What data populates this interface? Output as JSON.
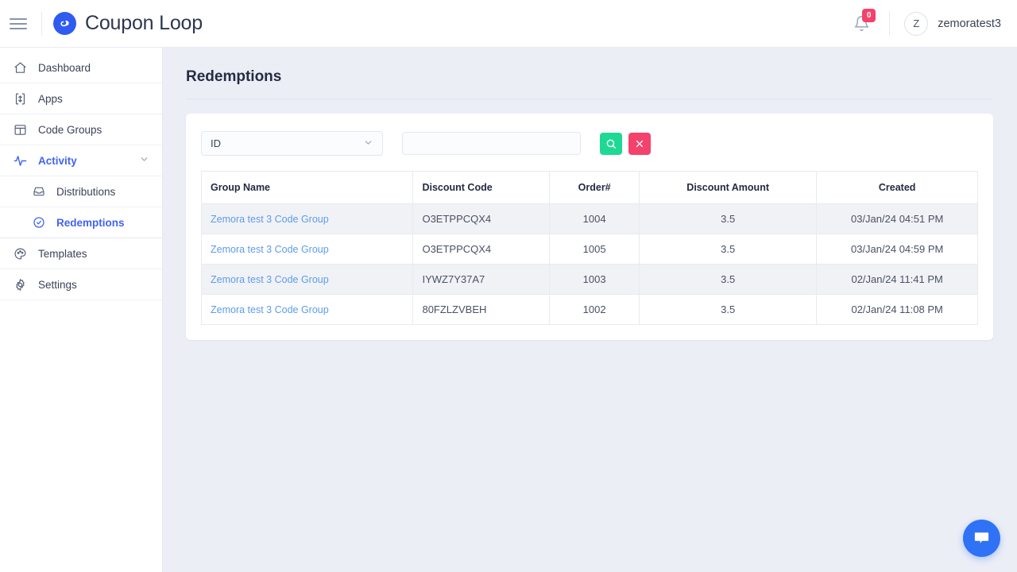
{
  "app": {
    "brand_name": "Coupon Loop",
    "logo_icon": "infinity-loop-icon",
    "menu_icon": "hamburger-menu-icon",
    "accent_blue": "#2f5bf0",
    "bg": "#eceef6"
  },
  "topbar": {
    "notifications": {
      "icon": "bell-icon",
      "badge_count": "0",
      "badge_color": "#f5426c"
    },
    "user": {
      "avatar_initial": "Z",
      "name": "zemoratest3"
    }
  },
  "sidebar": {
    "items": [
      {
        "label": "Dashboard",
        "icon": "home-icon",
        "active": false
      },
      {
        "label": "Apps",
        "icon": "apps-icon",
        "active": false
      },
      {
        "label": "Code Groups",
        "icon": "layout-icon",
        "active": false
      },
      {
        "label": "Activity",
        "icon": "activity-pulse-icon",
        "active": true,
        "expanded": true,
        "chevron": "chevron-down-icon"
      },
      {
        "label": "Templates",
        "icon": "palette-icon",
        "active": false
      },
      {
        "label": "Settings",
        "icon": "gear-icon",
        "active": false
      }
    ],
    "subitems": [
      {
        "label": "Distributions",
        "icon": "inbox-icon",
        "active": false
      },
      {
        "label": "Redemptions",
        "icon": "check-circle-icon",
        "active": true
      }
    ]
  },
  "page": {
    "title": "Redemptions"
  },
  "filters": {
    "field_select": {
      "value": "ID",
      "options": [
        "ID"
      ],
      "chevron": "chevron-down-icon"
    },
    "search_input": {
      "value": "",
      "placeholder": ""
    },
    "search_button": {
      "icon": "search-icon",
      "color": "#1ed994"
    },
    "clear_button": {
      "icon": "close-x-icon",
      "color": "#f5426c"
    }
  },
  "table": {
    "columns": [
      "Group Name",
      "Discount Code",
      "Order#",
      "Discount Amount",
      "Created"
    ],
    "rows": [
      {
        "group_name": "Zemora test 3 Code Group",
        "discount_code": "O3ETPPCQX4",
        "order": "1004",
        "discount_amount": "3.5",
        "created": "03/Jan/24 04:51 PM"
      },
      {
        "group_name": "Zemora test 3 Code Group",
        "discount_code": "O3ETPPCQX4",
        "order": "1005",
        "discount_amount": "3.5",
        "created": "03/Jan/24 04:59 PM"
      },
      {
        "group_name": "Zemora test 3 Code Group",
        "discount_code": "IYWZ7Y37A7",
        "order": "1003",
        "discount_amount": "3.5",
        "created": "02/Jan/24 11:41 PM"
      },
      {
        "group_name": "Zemora test 3 Code Group",
        "discount_code": "80FZLZVBEH",
        "order": "1002",
        "discount_amount": "3.5",
        "created": "02/Jan/24 11:08 PM"
      }
    ]
  },
  "chat_fab": {
    "icon": "chat-bubble-icon",
    "color": "#2f72f5"
  }
}
